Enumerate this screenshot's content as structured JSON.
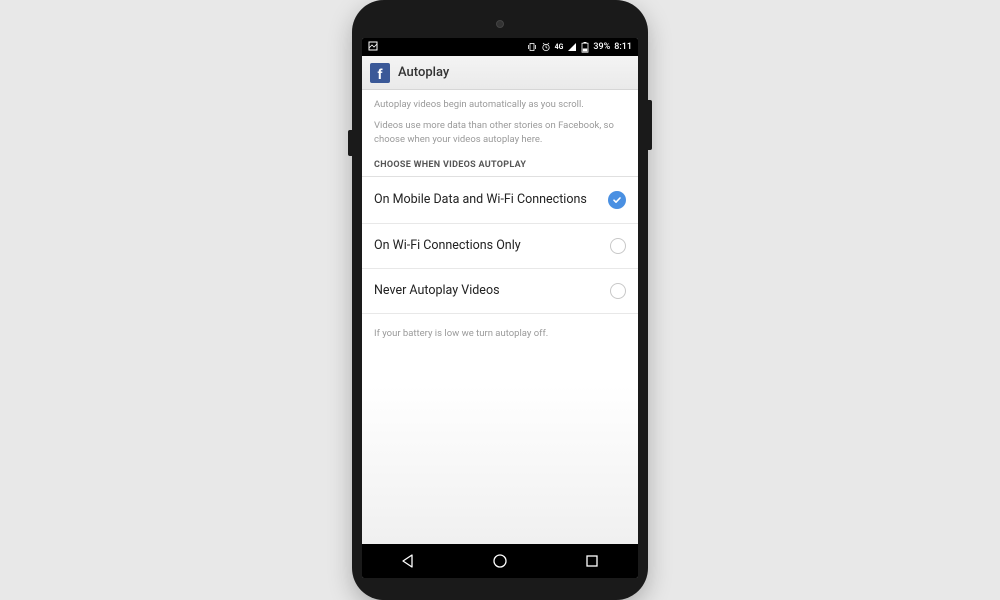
{
  "status_bar": {
    "battery_percent": "39%",
    "time": "8:11",
    "network_label": "4G"
  },
  "header": {
    "title": "Autoplay"
  },
  "description": {
    "line1": "Autoplay videos begin automatically as you scroll.",
    "line2": "Videos use more data than other stories on Facebook, so choose when your videos autoplay here."
  },
  "section_header": "CHOOSE WHEN VIDEOS AUTOPLAY",
  "options": [
    {
      "label": "On Mobile Data and Wi-Fi Connections",
      "selected": true
    },
    {
      "label": "On Wi-Fi Connections Only",
      "selected": false
    },
    {
      "label": "Never Autoplay Videos",
      "selected": false
    }
  ],
  "footer_note": "If your battery is low we turn autoplay off."
}
